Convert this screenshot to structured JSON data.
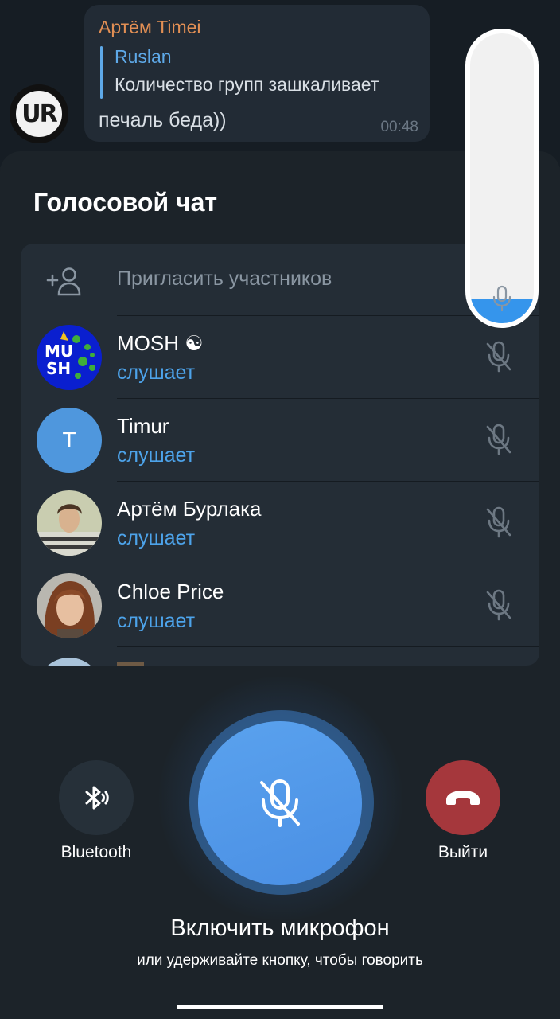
{
  "chat": {
    "avatar_text": "UR",
    "message": {
      "sender": "Артём Timei",
      "reply_to_name": "Ruslan",
      "reply_to_text": "Количество групп зашкаливает",
      "text": "печаль беда))",
      "time": "00:48"
    }
  },
  "voice_chat": {
    "title": "Голосовой чат",
    "invite_label": "Пригласить участников",
    "participants": [
      {
        "name": "MOSH ☯",
        "status": "слушает",
        "avatar_text": "MU SH"
      },
      {
        "name": "Timur",
        "status": "слушает",
        "avatar_letter": "T"
      },
      {
        "name": "Артём Бурлака",
        "status": "слушает"
      },
      {
        "name": "Chloe Price",
        "status": "слушает"
      }
    ]
  },
  "level_indicator": {
    "level": 0.085
  },
  "controls": {
    "bluetooth_label": "Bluetooth",
    "leave_label": "Выйти",
    "mic_title": "Включить микрофон",
    "mic_subtitle": "или удерживайте кнопку, чтобы говорить"
  },
  "colors": {
    "accent": "#4da3ea",
    "sender": "#e28f54",
    "leave": "#a5373c",
    "mic_button": "#4f97e8"
  }
}
